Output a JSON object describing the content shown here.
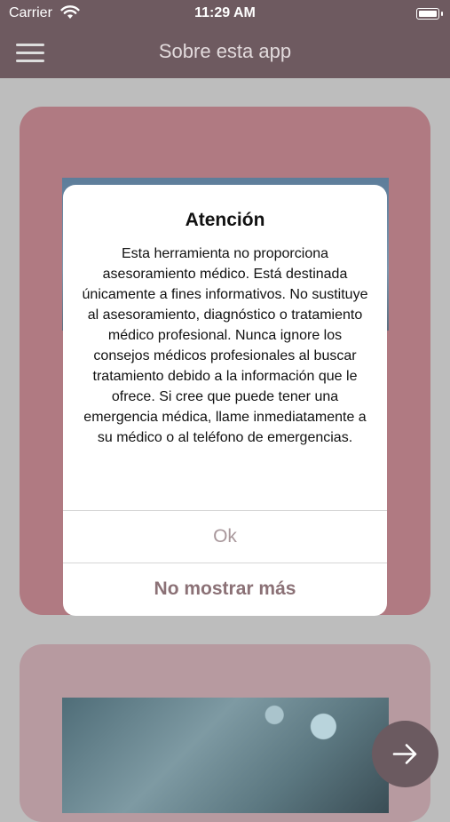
{
  "status_bar": {
    "carrier": "Carrier",
    "time": "11:29 AM",
    "wifi_icon": "wifi-icon",
    "battery_icon": "battery-icon"
  },
  "nav": {
    "title": "Sobre esta app",
    "menu_icon": "hamburger-menu-icon"
  },
  "dialog": {
    "title": "Atención",
    "message": "Esta herramienta no proporciona asesoramiento médico. Está destinada únicamente a fines informativos. No sustituye al asesoramiento, diagnóstico o tratamiento médico profesional. Nunca ignore los consejos médicos profesionales al buscar tratamiento debido a la información que le ofrece. Si cree que puede tener una emergencia médica, llame inmediatamente a su médico o al teléfono de emergencias.",
    "ok_label": "Ok",
    "dont_show_label": "No mostrar más"
  },
  "fab": {
    "icon": "arrow-right-icon"
  },
  "colors": {
    "nav_bg": "#6e5a60",
    "card_primary": "#b07a82",
    "card_secondary": "#b79aa0",
    "accent_text": "#8b7176"
  }
}
